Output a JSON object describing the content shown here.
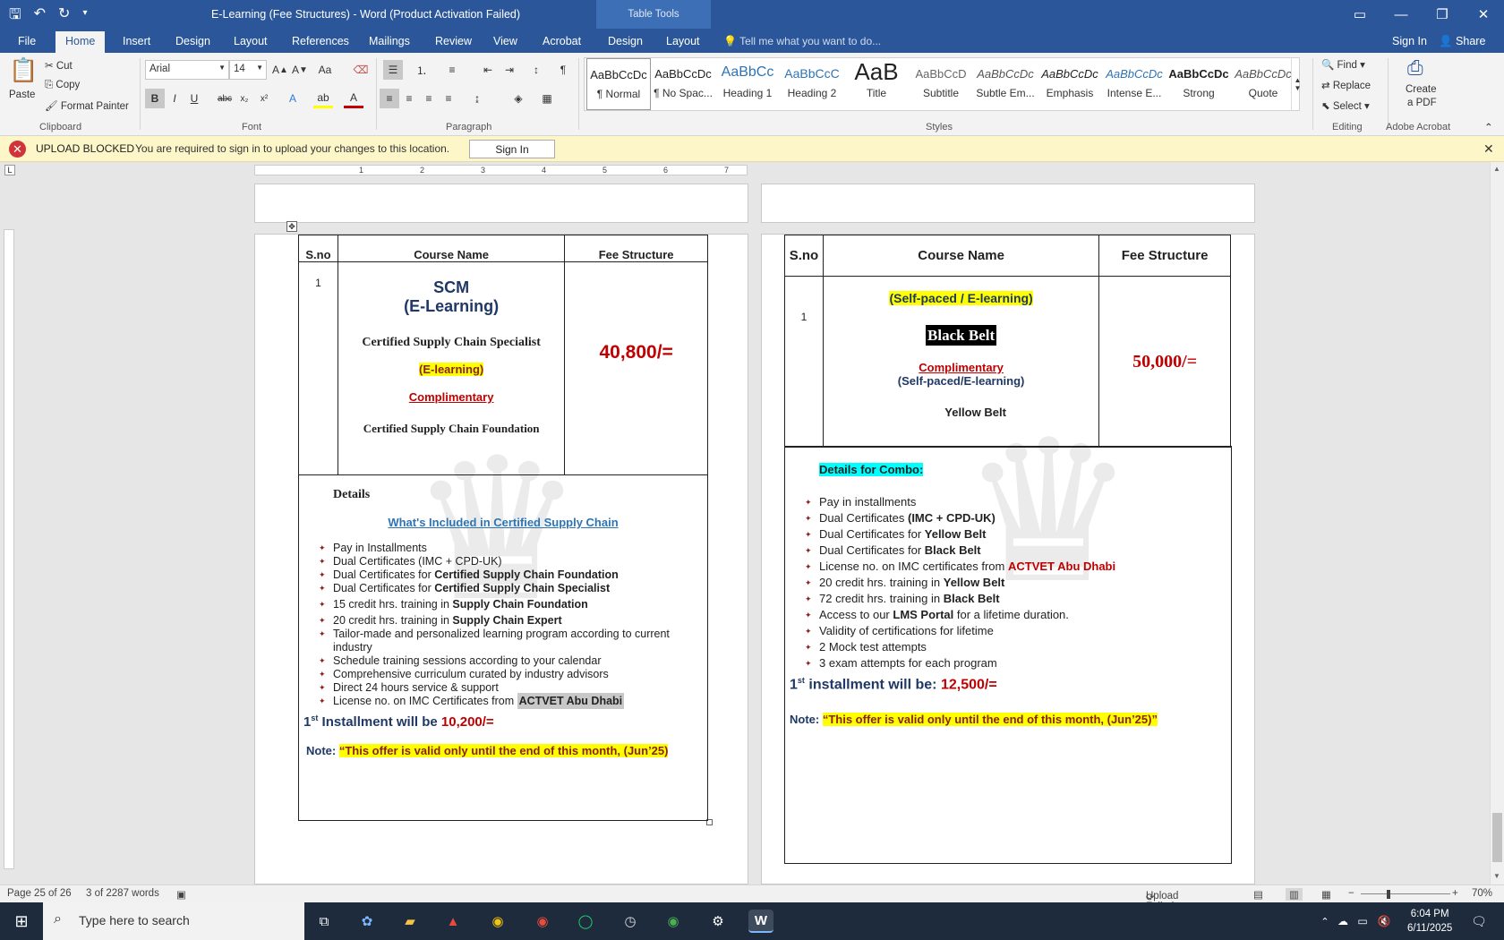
{
  "window": {
    "title": "E-Learning (Fee Structures) - Word (Product Activation Failed)",
    "contextual_group": "Table Tools",
    "tell_me": "Tell me what you want to do...",
    "sign_in": "Sign In",
    "share": "Share"
  },
  "tabs": [
    "File",
    "Home",
    "Insert",
    "Design",
    "Layout",
    "References",
    "Mailings",
    "Review",
    "View",
    "Acrobat",
    "Design",
    "Layout"
  ],
  "ribbon": {
    "clipboard": {
      "paste": "Paste",
      "cut": "Cut",
      "copy": "Copy",
      "format_painter": "Format Painter",
      "label": "Clipboard"
    },
    "font": {
      "name": "Arial",
      "size": "14",
      "label": "Font"
    },
    "paragraph": {
      "label": "Paragraph"
    },
    "styles": {
      "label": "Styles",
      "items": [
        {
          "preview": "AaBbCcDc",
          "name": "¶ Normal"
        },
        {
          "preview": "AaBbCcDc",
          "name": "¶ No Spac..."
        },
        {
          "preview": "AaBbCc",
          "name": "Heading 1"
        },
        {
          "preview": "AaBbCcC",
          "name": "Heading 2"
        },
        {
          "preview": "AaB",
          "name": "Title"
        },
        {
          "preview": "AaBbCcD",
          "name": "Subtitle"
        },
        {
          "preview": "AaBbCcDc",
          "name": "Subtle Em..."
        },
        {
          "preview": "AaBbCcDc",
          "name": "Emphasis"
        },
        {
          "preview": "AaBbCcDc",
          "name": "Intense E..."
        },
        {
          "preview": "AaBbCcDc",
          "name": "Strong"
        },
        {
          "preview": "AaBbCcDc",
          "name": "Quote"
        }
      ]
    },
    "editing": {
      "find": "Find",
      "replace": "Replace",
      "select": "Select",
      "label": "Editing"
    },
    "acrobat": {
      "create_pdf_1": "Create",
      "create_pdf_2": "a PDF",
      "label": "Adobe Acrobat"
    }
  },
  "infobar": {
    "title": "UPLOAD BLOCKED",
    "message": "You are required to sign in to upload your changes to this location.",
    "button": "Sign In"
  },
  "ruler_ticks": [
    "1",
    "2",
    "3",
    "4",
    "5",
    "6",
    "7"
  ],
  "left_table": {
    "headers": [
      "S.no",
      "Course Name",
      "Fee Structure"
    ],
    "sno": "1",
    "course_line1": "SCM",
    "course_line2": "(E-Learning)",
    "course_name": "Certified Supply Chain Specialist",
    "mode": "(E-learning)",
    "complimentary": "Complimentary",
    "foundation": "Certified Supply Chain Foundation",
    "fee": "40,800/=",
    "details_title": "Details",
    "included_title": "What's Included in Certified Supply Chain",
    "items": [
      {
        "pre": "Pay in Installments",
        "bold": ""
      },
      {
        "pre": "Dual Certificates (IMC + CPD-UK)",
        "bold": ""
      },
      {
        "pre": "Dual Certificates for ",
        "bold": "Certified Supply Chain Foundation"
      },
      {
        "pre": "Dual Certificates for ",
        "bold": "Certified Supply Chain Specialist"
      },
      {
        "pre": "15 credit hrs. training in ",
        "bold": "Supply Chain Foundation"
      },
      {
        "pre": "20 credit hrs. training in ",
        "bold": "Supply Chain Expert"
      },
      {
        "pre": "Tailor-made and personalized learning program according to current industry",
        "bold": ""
      },
      {
        "pre": "Schedule training sessions according to your calendar",
        "bold": ""
      },
      {
        "pre": "Comprehensive curriculum curated by industry advisors",
        "bold": ""
      },
      {
        "pre": "Direct 24 hours service & support",
        "bold": ""
      },
      {
        "pre": "License no. on IMC Certificates from ",
        "bold": "ACTVET Abu Dhabi"
      }
    ],
    "installment_pre": "1",
    "installment_sup": "st",
    "installment_text": " Installment will be ",
    "installment_amount": "10,200/=",
    "note_label": "Note: ",
    "note_text": "“This offer is valid only until the end of this month, (Jun’25)"
  },
  "right_table": {
    "headers": [
      "S.no",
      "Course Name",
      "Fee Structure"
    ],
    "sno": "1",
    "mode": "(Self-paced / E-learning)",
    "belt": "Black Belt",
    "complimentary": "Complimentary",
    "mode2": "(Self-paced/E-learning)",
    "yellow_belt": "Yellow Belt",
    "fee": "50,000/=",
    "combo_title": "Details for Combo:",
    "items": [
      {
        "pre": "Pay in installments",
        "bold": "",
        "red": ""
      },
      {
        "pre": "Dual Certificates ",
        "bold": "(IMC + CPD-UK)",
        "red": ""
      },
      {
        "pre": "Dual Certificates for ",
        "bold": "Yellow Belt",
        "red": ""
      },
      {
        "pre": "Dual Certificates for ",
        "bold": "Black Belt",
        "red": ""
      },
      {
        "pre": "License no. on IMC certificates from ",
        "bold": "",
        "red": "ACTVET Abu Dhabi"
      },
      {
        "pre": "20 credit hrs. training in ",
        "bold": "Yellow Belt",
        "red": ""
      },
      {
        "pre": "72 credit hrs. training in ",
        "bold": "Black Belt",
        "red": ""
      },
      {
        "pre": "Access to our ",
        "bold": "LMS Portal",
        "red": "",
        "post": " for a lifetime duration."
      },
      {
        "pre": "Validity of certifications for lifetime",
        "bold": "",
        "red": ""
      },
      {
        "pre": "2 Mock test attempts",
        "bold": "",
        "red": ""
      },
      {
        "pre": "3 exam attempts for each program",
        "bold": "",
        "red": ""
      }
    ],
    "installment_pre": "1",
    "installment_sup": "st",
    "installment_text": " installment will be: ",
    "installment_amount": "12,500/=",
    "note_label": "Note: ",
    "note_text": "“This offer is valid only until the end of this month, (Jun’25)”"
  },
  "status": {
    "page": "Page 25 of 26",
    "words": "3 of 2287 words",
    "upload": "Upload Failed",
    "zoom": "70%"
  },
  "taskbar": {
    "search_placeholder": "Type here to search",
    "time": "6:04 PM",
    "date": "6/11/2025"
  },
  "colors": {
    "word_blue": "#2b579a",
    "highlight_yellow": "#ffff00",
    "highlight_cyan": "#00ffff",
    "red": "#c00000"
  }
}
